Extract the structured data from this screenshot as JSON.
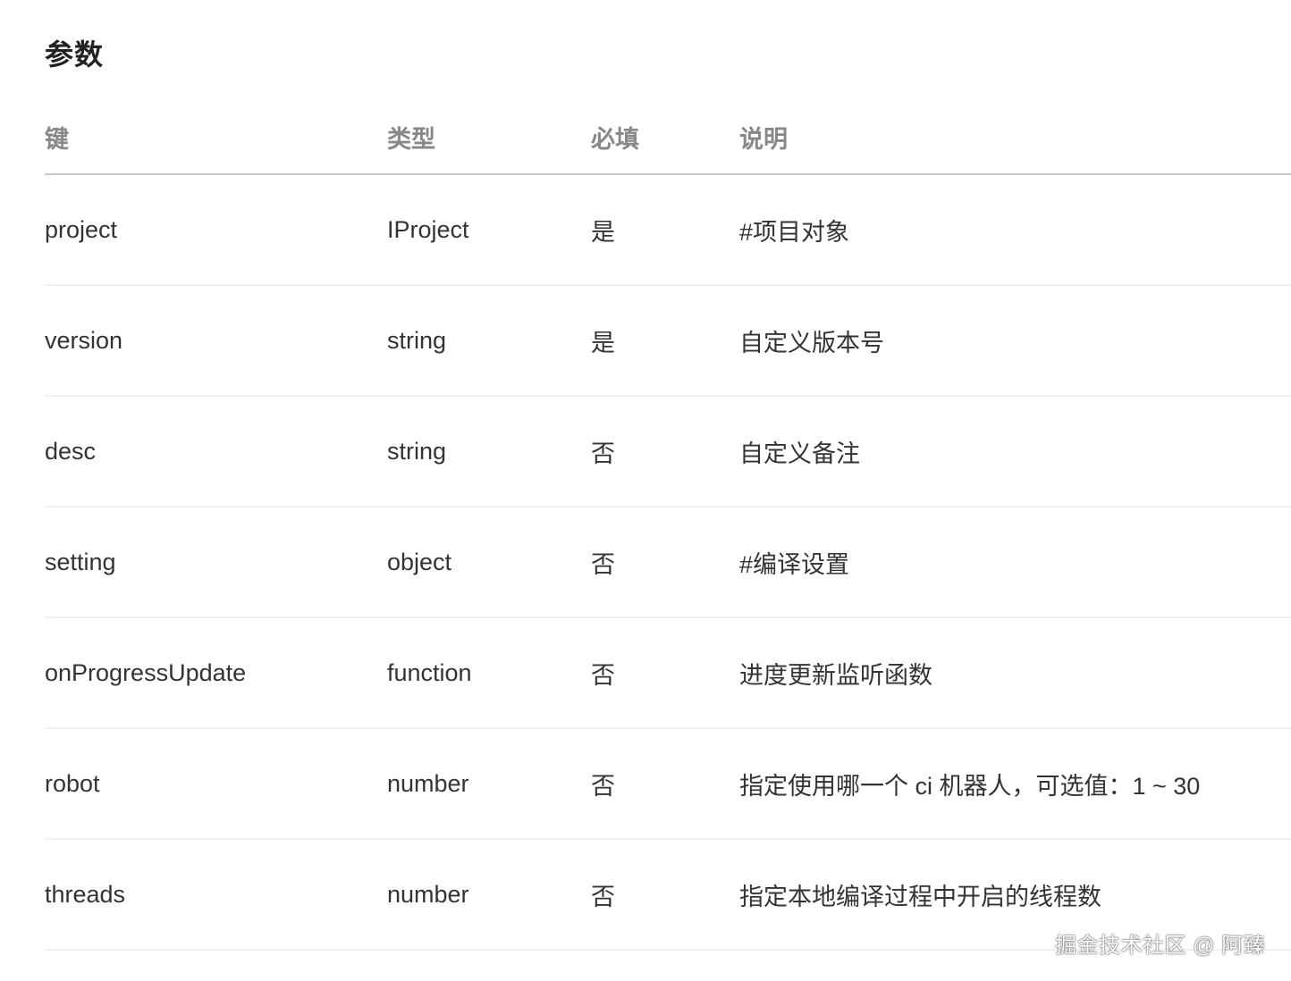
{
  "section": {
    "title": "参数"
  },
  "table": {
    "headers": {
      "key": "键",
      "type": "类型",
      "required": "必填",
      "description": "说明"
    },
    "rows": [
      {
        "key": "project",
        "type": "IProject",
        "required": "是",
        "description": "#项目对象"
      },
      {
        "key": "version",
        "type": "string",
        "required": "是",
        "description": "自定义版本号"
      },
      {
        "key": "desc",
        "type": "string",
        "required": "否",
        "description": "自定义备注"
      },
      {
        "key": "setting",
        "type": "object",
        "required": "否",
        "description": "#编译设置"
      },
      {
        "key": "onProgressUpdate",
        "type": "function",
        "required": "否",
        "description": "进度更新监听函数"
      },
      {
        "key": "robot",
        "type": "number",
        "required": "否",
        "description": "指定使用哪一个 ci 机器人，可选值：1 ~ 30"
      },
      {
        "key": "threads",
        "type": "number",
        "required": "否",
        "description": "指定本地编译过程中开启的线程数"
      }
    ]
  },
  "watermark": {
    "text": "掘金技术社区 @ 阿臻"
  }
}
